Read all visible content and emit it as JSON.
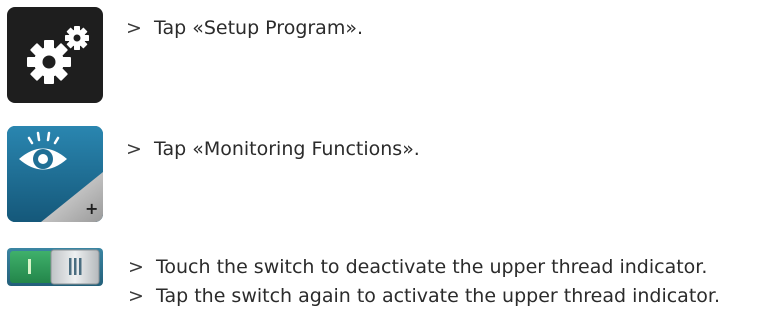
{
  "steps": [
    {
      "marker": ">",
      "text": "Tap «Setup Program»."
    },
    {
      "marker": ">",
      "text": "Tap «Monitoring Functions»."
    },
    {
      "marker": ">",
      "text": "Touch the switch to deactivate the upper thread indicator."
    },
    {
      "marker": ">",
      "text": "Tap the switch again to activate the upper thread indicator."
    }
  ],
  "icons": {
    "setup": "gears-icon",
    "monitoring": "eye-icon",
    "switch": "toggle-switch-icon"
  },
  "colors": {
    "setup_bg": "#1e1e1e",
    "monitoring_bg": "#1f6f95",
    "switch_on": "#2e9a58",
    "switch_off": "#2e6e86"
  }
}
